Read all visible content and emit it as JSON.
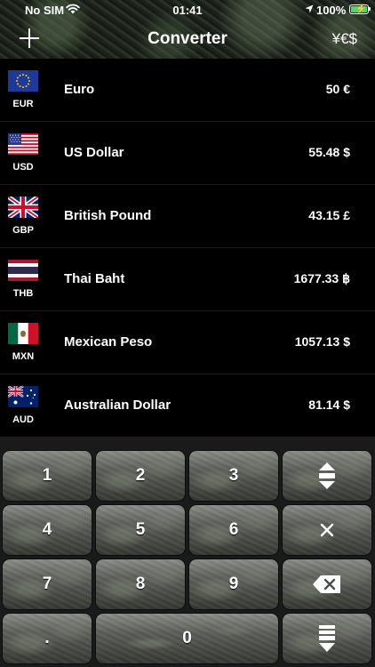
{
  "status_bar": {
    "carrier": "No SIM",
    "time": "01:41",
    "battery": "100%"
  },
  "nav": {
    "title": "Converter",
    "add_icon": "plus-icon",
    "currency_button": "¥€$"
  },
  "currencies": [
    {
      "code": "EUR",
      "name": "Euro",
      "amount": "50 €",
      "flag": "eu"
    },
    {
      "code": "USD",
      "name": "US Dollar",
      "amount": "55.48 $",
      "flag": "us"
    },
    {
      "code": "GBP",
      "name": "British Pound",
      "amount": "43.15 £",
      "flag": "gb"
    },
    {
      "code": "THB",
      "name": "Thai Baht",
      "amount": "1677.33 ฿",
      "flag": "th"
    },
    {
      "code": "MXN",
      "name": "Mexican Peso",
      "amount": "1057.13 $",
      "flag": "mx"
    },
    {
      "code": "AUD",
      "name": "Australian Dollar",
      "amount": "81.14 $",
      "flag": "au"
    }
  ],
  "keypad": {
    "keys": [
      "1",
      "2",
      "3",
      "4",
      "5",
      "6",
      "7",
      "8",
      "9",
      ".",
      "0"
    ],
    "icons": {
      "swap": "swap-up-down-icon",
      "clear": "close-icon",
      "backspace": "backspace-icon",
      "collapse": "collapse-down-icon"
    }
  },
  "colors": {
    "battery": "#4cd964",
    "background": "#000000"
  }
}
